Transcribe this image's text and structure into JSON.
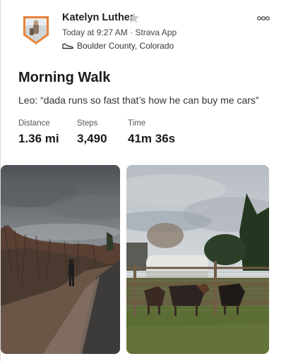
{
  "post": {
    "athlete_name": "Katelyn Luther",
    "timestamp": "Today at 9:27 AM",
    "separator": " · ",
    "app": "Strava App",
    "location": "Boulder County, Colorado",
    "title": "Morning Walk",
    "description": "Leo: “dada runs so fast that’s how he can buy me cars”"
  },
  "stats": [
    {
      "label": "Distance",
      "value": "1.36 mi"
    },
    {
      "label": "Steps",
      "value": "3,490"
    },
    {
      "label": "Time",
      "value": "41m 36s"
    }
  ],
  "icons": {
    "avatar": "avatar-badge",
    "star": "star-icon",
    "location": "shoe-icon",
    "menu": "more-options-icon"
  },
  "colors": {
    "avatar_border": "#e8833a",
    "star": "#c9c9c9",
    "text_primary": "#1a1a1a",
    "text_secondary": "#555555"
  }
}
